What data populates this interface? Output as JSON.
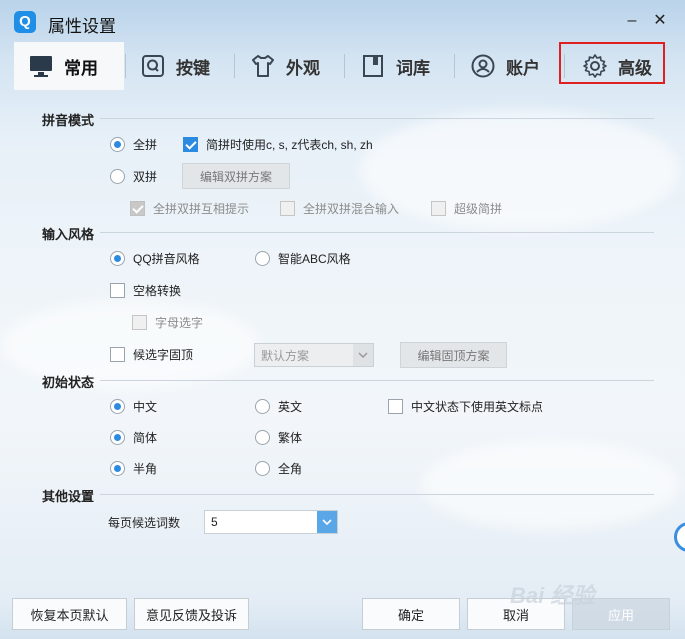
{
  "window": {
    "title": "属性设置",
    "app_icon_letter": "Q"
  },
  "tabs": [
    {
      "label": "常用",
      "icon": "monitor-icon",
      "active": true
    },
    {
      "label": "按键",
      "icon": "key-q-icon",
      "active": false
    },
    {
      "label": "外观",
      "icon": "shirt-icon",
      "active": false
    },
    {
      "label": "词库",
      "icon": "book-icon",
      "active": false
    },
    {
      "label": "账户",
      "icon": "user-icon",
      "active": false
    },
    {
      "label": "高级",
      "icon": "gear-icon",
      "active": false,
      "highlighted": true
    }
  ],
  "pinyin": {
    "title": "拼音模式",
    "full": "全拼",
    "jianpin": "简拼时使用c, s, z代表ch, sh, zh",
    "double": "双拼",
    "edit_double": "编辑双拼方案",
    "hint": "全拼双拼互相提示",
    "mixed": "全拼双拼混合输入",
    "super": "超级简拼"
  },
  "style": {
    "title": "输入风格",
    "qq": "QQ拼音风格",
    "abc": "智能ABC风格",
    "space": "空格转换",
    "letter": "字母选字",
    "fixed": "候选字固顶",
    "default_scheme": "默认方案",
    "edit_fixed": "编辑固顶方案"
  },
  "initial": {
    "title": "初始状态",
    "chinese": "中文",
    "english": "英文",
    "eng_punct": "中文状态下使用英文标点",
    "simplified": "简体",
    "traditional": "繁体",
    "half": "半角",
    "full": "全角"
  },
  "other": {
    "title": "其他设置",
    "per_page_label": "每页候选词数",
    "per_page_value": "5"
  },
  "footer": {
    "restore": "恢复本页默认",
    "feedback": "意见反馈及投诉",
    "ok": "确定",
    "cancel": "取消",
    "apply": "应用"
  },
  "watermark": "Bai 经验",
  "colors": {
    "accent": "#2c8be0",
    "highlight_box": "#e02020"
  }
}
